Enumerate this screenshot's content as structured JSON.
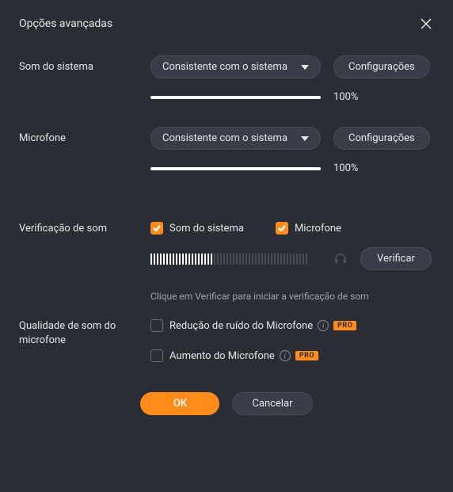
{
  "dialog": {
    "title": "Opções avançadas"
  },
  "system_sound": {
    "label": "Som do sistema",
    "selected": "Consistente com o sistema",
    "settings_btn": "Configurações",
    "volume_percent": "100%"
  },
  "microphone": {
    "label": "Microfone",
    "selected": "Consistente com o sistema",
    "settings_btn": "Configurações",
    "volume_percent": "100%"
  },
  "sound_check": {
    "label": "Verificação de som",
    "system_checkbox": "Som do sistema",
    "mic_checkbox": "Microfone",
    "verify_btn": "Verificar",
    "hint": "Clique em Verificar para iniciar a verificação de som"
  },
  "mic_quality": {
    "label": "Qualidade de som do microfone",
    "noise_reduction": "Redução de ruído do Microfone",
    "boost": "Aumento do Microfone",
    "pro_badge": "PRO"
  },
  "footer": {
    "ok": "OK",
    "cancel": "Cancelar"
  }
}
